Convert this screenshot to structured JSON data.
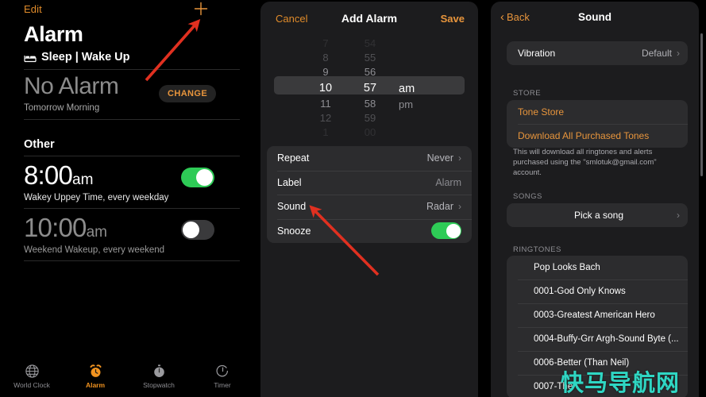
{
  "colors": {
    "accent_orange": "#e8953c",
    "toggle_green": "#2ecb56",
    "arrow_red": "#e03020",
    "card_gray": "#2c2c2e",
    "sheet_gray": "#1c1c1e",
    "watermark_teal": "#2fd6c3"
  },
  "left_panel": {
    "edit_label": "Edit",
    "add_icon": "plus-icon",
    "page_title": "Alarm",
    "sleep_section": {
      "icon": "bed-icon",
      "header": "Sleep | Wake Up",
      "time": "No Alarm",
      "subtitle": "Tomorrow Morning",
      "change_label": "CHANGE"
    },
    "other_section": {
      "header": "Other",
      "alarms": [
        {
          "time": "8:00",
          "meridiem": "am",
          "description": "Wakey Uppey Time, every weekday",
          "enabled": true
        },
        {
          "time": "10:00",
          "meridiem": "am",
          "description": "Weekend Wakeup, every weekend",
          "enabled": false
        }
      ]
    },
    "tabbar": [
      {
        "icon": "globe-icon",
        "label": "World Clock",
        "active": false
      },
      {
        "icon": "alarm-clock-icon",
        "label": "Alarm",
        "active": true
      },
      {
        "icon": "stopwatch-icon",
        "label": "Stopwatch",
        "active": false
      },
      {
        "icon": "timer-icon",
        "label": "Timer",
        "active": false
      }
    ]
  },
  "mid_panel": {
    "cancel_label": "Cancel",
    "title": "Add Alarm",
    "save_label": "Save",
    "time_picker": {
      "hours": [
        "7",
        "8",
        "9",
        "10",
        "11",
        "12",
        "1"
      ],
      "minutes": [
        "54",
        "55",
        "56",
        "57",
        "58",
        "59",
        "00"
      ],
      "meridiems": [
        "am",
        "pm"
      ],
      "selected_hour": "10",
      "selected_minute": "57",
      "selected_meridiem": "am"
    },
    "options": [
      {
        "label": "Repeat",
        "value": "Never",
        "chevron": true,
        "type": "value"
      },
      {
        "label": "Label",
        "value": "Alarm",
        "chevron": false,
        "type": "dim"
      },
      {
        "label": "Sound",
        "value": "Radar",
        "chevron": true,
        "type": "value"
      },
      {
        "label": "Snooze",
        "value": "",
        "chevron": false,
        "type": "toggle",
        "enabled": true
      }
    ]
  },
  "right_panel": {
    "back_label": "Back",
    "title": "Sound",
    "vibration": {
      "label": "Vibration",
      "value": "Default"
    },
    "store_header": "STORE",
    "store_items": [
      "Tone Store",
      "Download All Purchased Tones"
    ],
    "store_note": "This will download all ringtones and alerts purchased using the \"smlotuk@gmail.com\" account.",
    "songs_header": "SONGS",
    "pick_a_song": "Pick a song",
    "ringtones_header": "RINGTONES",
    "ringtones": [
      "Pop Looks Bach",
      "0001-God Only Knows",
      "0003-Greatest American Hero",
      "0004-Buffy-Grr Argh-Sound Byte (...",
      "0006-Better (Than Neil)",
      "0007-The"
    ]
  },
  "watermark": {
    "text": "快马导航网"
  }
}
